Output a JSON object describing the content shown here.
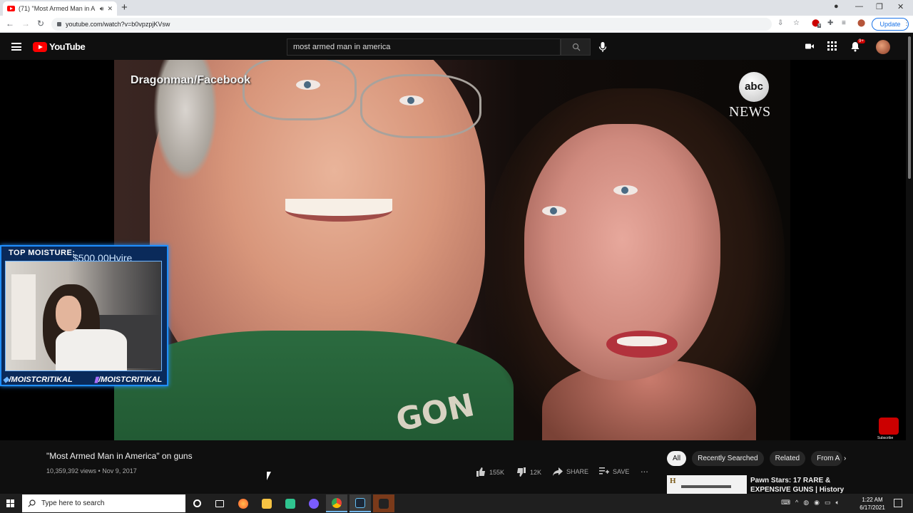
{
  "browser": {
    "tab_title": "(71) \"Most Armed Man in A",
    "new_tab": "+",
    "url": "youtube.com/watch?v=b0vpzpjKVsw",
    "update_label": "Update",
    "ext_badge": "9"
  },
  "youtube": {
    "logo_text": "YouTube",
    "search_value": "most armed man in america",
    "notification_count": "9+"
  },
  "video": {
    "credit": "Dragonman/Facebook",
    "network_logo": "abc",
    "network_name": "NEWS",
    "shirt_text": "GON",
    "watermark_label": "Subscribe"
  },
  "overlay": {
    "title": "TOP MOISTURE:",
    "amount": "$500.00Hvire",
    "handle_left": "/MOISTCRITIKAL",
    "handle_right": "/MOISTCRITIKAL"
  },
  "watch": {
    "title": "\"Most Armed Man in America\" on guns",
    "meta": "10,359,392 views • Nov 9, 2017",
    "likes": "155K",
    "dislikes": "12K",
    "share_label": "SHARE",
    "save_label": "SAVE",
    "more": "..."
  },
  "chips": [
    "All",
    "Recently Searched",
    "Related",
    "From A"
  ],
  "chips_next": "›",
  "recommendation": {
    "thumb_letter": "H",
    "title": "Pawn Stars: 17 RARE & EXPENSIVE GUNS | History"
  },
  "taskbar": {
    "search_placeholder": "Type here to search",
    "time": "1:22 AM",
    "date": "6/17/2021"
  },
  "colors": {
    "yt_red": "#ff0000",
    "overlay_blue": "#1f8fff",
    "shirt_green": "#2b6b3f"
  }
}
